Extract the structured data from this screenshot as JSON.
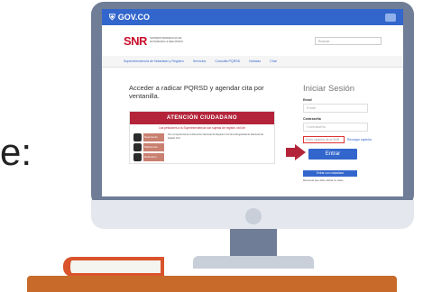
{
  "side_text": "e:",
  "browser": {
    "gov_logo": "GOV.CO",
    "gov_shield": "⛨",
    "header": {
      "logo": "SNR",
      "logo_sub": "SUPERINTENDENCIA DE NOTARIADO & REGISTRO",
      "search_placeholder": "Buscar"
    },
    "nav_items": [
      "Superintendencia de Notariado y Registro",
      "Servicios",
      "Consulta PQRSD",
      "Noticias",
      "Chat"
    ],
    "page": {
      "title": "Acceder a radicar PQRSD y agendar cita por ventanilla.",
      "atencion": {
        "heading": "ATENCIÓN CIUDADANO",
        "intro": "Las peticiones a la Superintendencia son sujetas de registro civil de",
        "categories": [
          "Nacimiento",
          "Matrimonio",
          "Defunción"
        ],
        "text": "Son competencia de la Dirección Nacional de Registro Civil de la Registraduría Nacional del Estado Civil"
      }
    },
    "login": {
      "title": "Iniciar Sesión",
      "email_label": "Email",
      "email_placeholder": "Email",
      "password_label": "Contraseña",
      "password_placeholder": "Contraseña",
      "captcha_placeholder": "Enter captcha de la SNR",
      "captcha_link": "Recargar captcha",
      "enter_button": "Entrar",
      "register_button": "Entrar con ciudadano",
      "forgot_text": "Recuerde que debe utilizar su clave"
    }
  },
  "colors": {
    "gov_blue": "#3366cc",
    "snr_red": "#c8102e",
    "atencion_red": "#b3243a",
    "monitor": "#6f7d96",
    "desk": "#c86a2a"
  }
}
